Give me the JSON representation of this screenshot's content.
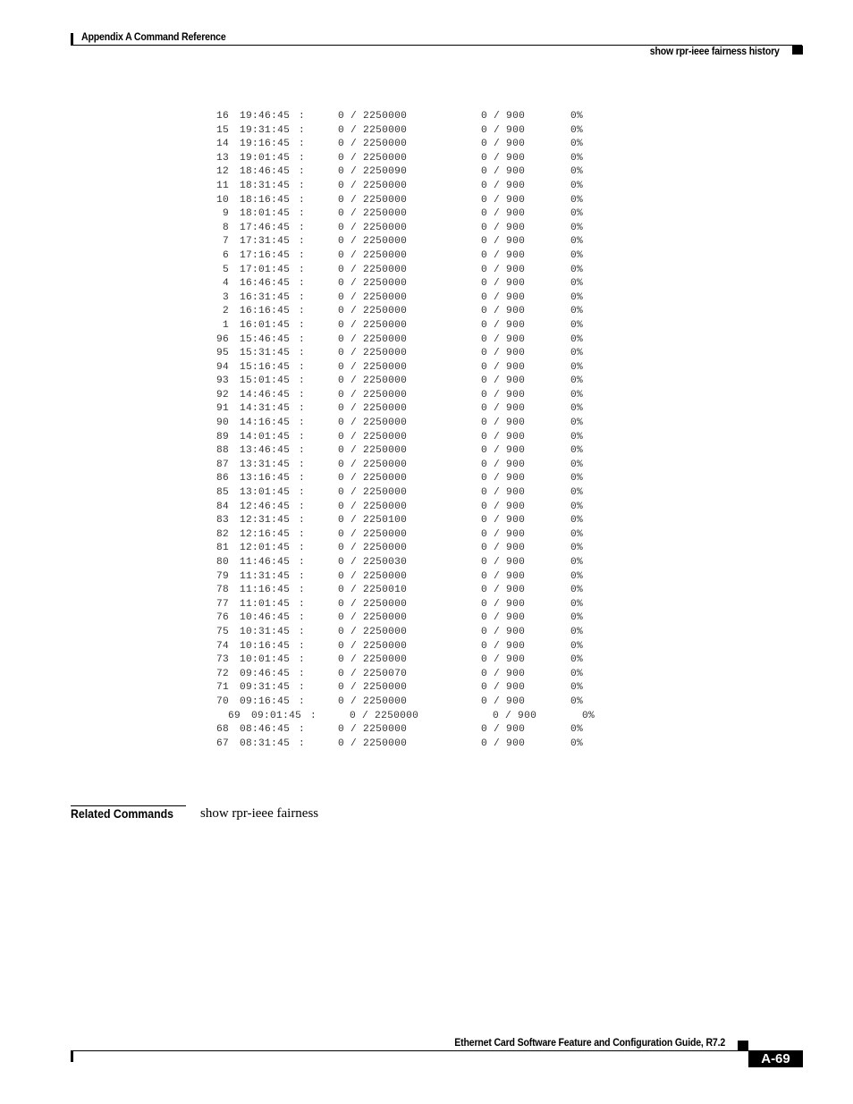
{
  "header": {
    "section": "Appendix A Command Reference",
    "command": "show rpr-ieee fairness history"
  },
  "listing": {
    "rows": [
      {
        "idx": "16",
        "time": "19:46:45",
        "a": "0",
        "a_total": "2250000",
        "b": "0",
        "b_total": "900",
        "pct": "0%"
      },
      {
        "idx": "15",
        "time": "19:31:45",
        "a": "0",
        "a_total": "2250000",
        "b": "0",
        "b_total": "900",
        "pct": "0%"
      },
      {
        "idx": "14",
        "time": "19:16:45",
        "a": "0",
        "a_total": "2250000",
        "b": "0",
        "b_total": "900",
        "pct": "0%"
      },
      {
        "idx": "13",
        "time": "19:01:45",
        "a": "0",
        "a_total": "2250000",
        "b": "0",
        "b_total": "900",
        "pct": "0%"
      },
      {
        "idx": "12",
        "time": "18:46:45",
        "a": "0",
        "a_total": "2250090",
        "b": "0",
        "b_total": "900",
        "pct": "0%"
      },
      {
        "idx": "11",
        "time": "18:31:45",
        "a": "0",
        "a_total": "2250000",
        "b": "0",
        "b_total": "900",
        "pct": "0%"
      },
      {
        "idx": "10",
        "time": "18:16:45",
        "a": "0",
        "a_total": "2250000",
        "b": "0",
        "b_total": "900",
        "pct": "0%"
      },
      {
        "idx": "9",
        "time": "18:01:45",
        "a": "0",
        "a_total": "2250000",
        "b": "0",
        "b_total": "900",
        "pct": "0%"
      },
      {
        "idx": "8",
        "time": "17:46:45",
        "a": "0",
        "a_total": "2250000",
        "b": "0",
        "b_total": "900",
        "pct": "0%"
      },
      {
        "idx": "7",
        "time": "17:31:45",
        "a": "0",
        "a_total": "2250000",
        "b": "0",
        "b_total": "900",
        "pct": "0%"
      },
      {
        "idx": "6",
        "time": "17:16:45",
        "a": "0",
        "a_total": "2250000",
        "b": "0",
        "b_total": "900",
        "pct": "0%"
      },
      {
        "idx": "5",
        "time": "17:01:45",
        "a": "0",
        "a_total": "2250000",
        "b": "0",
        "b_total": "900",
        "pct": "0%"
      },
      {
        "idx": "4",
        "time": "16:46:45",
        "a": "0",
        "a_total": "2250000",
        "b": "0",
        "b_total": "900",
        "pct": "0%"
      },
      {
        "idx": "3",
        "time": "16:31:45",
        "a": "0",
        "a_total": "2250000",
        "b": "0",
        "b_total": "900",
        "pct": "0%"
      },
      {
        "idx": "2",
        "time": "16:16:45",
        "a": "0",
        "a_total": "2250000",
        "b": "0",
        "b_total": "900",
        "pct": "0%"
      },
      {
        "idx": "1",
        "time": "16:01:45",
        "a": "0",
        "a_total": "2250000",
        "b": "0",
        "b_total": "900",
        "pct": "0%"
      },
      {
        "idx": "96",
        "time": "15:46:45",
        "a": "0",
        "a_total": "2250000",
        "b": "0",
        "b_total": "900",
        "pct": "0%"
      },
      {
        "idx": "95",
        "time": "15:31:45",
        "a": "0",
        "a_total": "2250000",
        "b": "0",
        "b_total": "900",
        "pct": "0%"
      },
      {
        "idx": "94",
        "time": "15:16:45",
        "a": "0",
        "a_total": "2250000",
        "b": "0",
        "b_total": "900",
        "pct": "0%"
      },
      {
        "idx": "93",
        "time": "15:01:45",
        "a": "0",
        "a_total": "2250000",
        "b": "0",
        "b_total": "900",
        "pct": "0%"
      },
      {
        "idx": "92",
        "time": "14:46:45",
        "a": "0",
        "a_total": "2250000",
        "b": "0",
        "b_total": "900",
        "pct": "0%"
      },
      {
        "idx": "91",
        "time": "14:31:45",
        "a": "0",
        "a_total": "2250000",
        "b": "0",
        "b_total": "900",
        "pct": "0%"
      },
      {
        "idx": "90",
        "time": "14:16:45",
        "a": "0",
        "a_total": "2250000",
        "b": "0",
        "b_total": "900",
        "pct": "0%"
      },
      {
        "idx": "89",
        "time": "14:01:45",
        "a": "0",
        "a_total": "2250000",
        "b": "0",
        "b_total": "900",
        "pct": "0%"
      },
      {
        "idx": "88",
        "time": "13:46:45",
        "a": "0",
        "a_total": "2250000",
        "b": "0",
        "b_total": "900",
        "pct": "0%"
      },
      {
        "idx": "87",
        "time": "13:31:45",
        "a": "0",
        "a_total": "2250000",
        "b": "0",
        "b_total": "900",
        "pct": "0%"
      },
      {
        "idx": "86",
        "time": "13:16:45",
        "a": "0",
        "a_total": "2250000",
        "b": "0",
        "b_total": "900",
        "pct": "0%"
      },
      {
        "idx": "85",
        "time": "13:01:45",
        "a": "0",
        "a_total": "2250000",
        "b": "0",
        "b_total": "900",
        "pct": "0%"
      },
      {
        "idx": "84",
        "time": "12:46:45",
        "a": "0",
        "a_total": "2250000",
        "b": "0",
        "b_total": "900",
        "pct": "0%"
      },
      {
        "idx": "83",
        "time": "12:31:45",
        "a": "0",
        "a_total": "2250100",
        "b": "0",
        "b_total": "900",
        "pct": "0%"
      },
      {
        "idx": "82",
        "time": "12:16:45",
        "a": "0",
        "a_total": "2250000",
        "b": "0",
        "b_total": "900",
        "pct": "0%"
      },
      {
        "idx": "81",
        "time": "12:01:45",
        "a": "0",
        "a_total": "2250000",
        "b": "0",
        "b_total": "900",
        "pct": "0%"
      },
      {
        "idx": "80",
        "time": "11:46:45",
        "a": "0",
        "a_total": "2250030",
        "b": "0",
        "b_total": "900",
        "pct": "0%"
      },
      {
        "idx": "79",
        "time": "11:31:45",
        "a": "0",
        "a_total": "2250000",
        "b": "0",
        "b_total": "900",
        "pct": "0%"
      },
      {
        "idx": "78",
        "time": "11:16:45",
        "a": "0",
        "a_total": "2250010",
        "b": "0",
        "b_total": "900",
        "pct": "0%"
      },
      {
        "idx": "77",
        "time": "11:01:45",
        "a": "0",
        "a_total": "2250000",
        "b": "0",
        "b_total": "900",
        "pct": "0%"
      },
      {
        "idx": "76",
        "time": "10:46:45",
        "a": "0",
        "a_total": "2250000",
        "b": "0",
        "b_total": "900",
        "pct": "0%"
      },
      {
        "idx": "75",
        "time": "10:31:45",
        "a": "0",
        "a_total": "2250000",
        "b": "0",
        "b_total": "900",
        "pct": "0%"
      },
      {
        "idx": "74",
        "time": "10:16:45",
        "a": "0",
        "a_total": "2250000",
        "b": "0",
        "b_total": "900",
        "pct": "0%"
      },
      {
        "idx": "73",
        "time": "10:01:45",
        "a": "0",
        "a_total": "2250000",
        "b": "0",
        "b_total": "900",
        "pct": "0%"
      },
      {
        "idx": "72",
        "time": "09:46:45",
        "a": "0",
        "a_total": "2250070",
        "b": "0",
        "b_total": "900",
        "pct": "0%"
      },
      {
        "idx": "71",
        "time": "09:31:45",
        "a": "0",
        "a_total": "2250000",
        "b": "0",
        "b_total": "900",
        "pct": "0%"
      },
      {
        "idx": "70",
        "time": "09:16:45",
        "a": "0",
        "a_total": "2250000",
        "b": "0",
        "b_total": "900",
        "pct": "0%"
      },
      {
        "idx": "69",
        "time": "09:01:45",
        "a": "0",
        "a_total": "2250000",
        "b": "0",
        "b_total": "900",
        "pct": "0%",
        "shifted": true
      },
      {
        "idx": "68",
        "time": "08:46:45",
        "a": "0",
        "a_total": "2250000",
        "b": "0",
        "b_total": "900",
        "pct": "0%"
      },
      {
        "idx": "67",
        "time": "08:31:45",
        "a": "0",
        "a_total": "2250000",
        "b": "0",
        "b_total": "900",
        "pct": "0%"
      }
    ]
  },
  "related": {
    "label": "Related Commands",
    "command": "show rpr-ieee fairness"
  },
  "footer": {
    "guide_title": "Ethernet Card Software Feature and Configuration Guide, R7.2",
    "page_number": "A-69"
  }
}
